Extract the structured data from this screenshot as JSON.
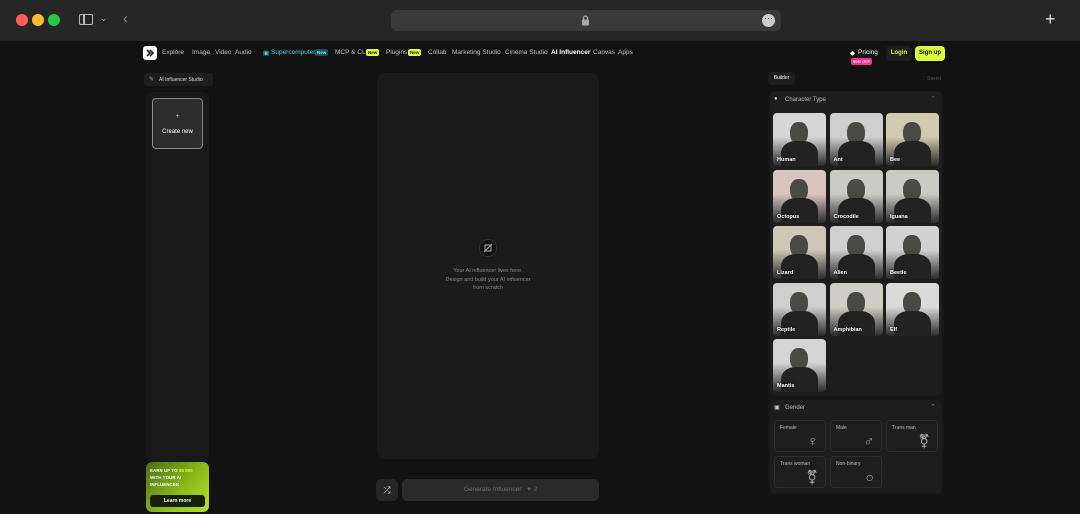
{
  "nav": {
    "items": [
      "Explore",
      "Image",
      "Video",
      "Audio"
    ],
    "supercomputer": "Supercomputer",
    "supercomputer_badge": "New",
    "mcp": "MCP & CLI",
    "mcp_badge": "New",
    "plugins": "Plugins",
    "plugins_badge": "New",
    "more": [
      "Collab",
      "Marketing Studio",
      "Cinema Studio"
    ],
    "active": "AI Influencer",
    "tail": [
      "Canvas",
      "Apps"
    ],
    "pricing": "Pricing",
    "pricing_badge": "50% OFF",
    "login": "Login",
    "signup": "Sign up"
  },
  "left": {
    "studio_tab": "AI Influencer Studio",
    "create_plus": "+",
    "create_label": "Create new",
    "promo_line1": "EARN UP TO",
    "promo_amount": "$5 000",
    "promo_line2": "WITH YOUR AI",
    "promo_line3": "INFLUENCER",
    "promo_button": "Learn more"
  },
  "center": {
    "empty_line1": "Your AI influencer lives here.",
    "empty_line2": "Design and build your AI influencer",
    "empty_line3": "from scratch",
    "generate_label": "Generate Influencer",
    "generate_cost": "2"
  },
  "right": {
    "tab_builder": "Builder",
    "tab_saved": "Saved",
    "character_title": "Character Type",
    "characters": [
      {
        "label": "Human",
        "color": "#d6d6d6"
      },
      {
        "label": "Ant",
        "color": "#cfcfcf"
      },
      {
        "label": "Bee",
        "color": "#d1c9b0"
      },
      {
        "label": "Octopus",
        "color": "#d9c4c0"
      },
      {
        "label": "Crocodile",
        "color": "#c9cbc3"
      },
      {
        "label": "Iguana",
        "color": "#c8cbc2"
      },
      {
        "label": "Lizard",
        "color": "#cfc8b8"
      },
      {
        "label": "Alien",
        "color": "#cfcfcf"
      },
      {
        "label": "Beetle",
        "color": "#d2d2d2"
      },
      {
        "label": "Reptile",
        "color": "#cfcfcf"
      },
      {
        "label": "Amphibian",
        "color": "#d0cdc4"
      },
      {
        "label": "Elf",
        "color": "#dadada"
      },
      {
        "label": "Mantis",
        "color": "#d4d4d4"
      }
    ],
    "gender_title": "Gender",
    "genders": [
      {
        "label": "Female",
        "symbol": "♀"
      },
      {
        "label": "Male",
        "symbol": "♂"
      },
      {
        "label": "Trans man",
        "symbol": "⚧"
      },
      {
        "label": "Trans woman",
        "symbol": "⚧"
      },
      {
        "label": "Non-binary",
        "symbol": "○"
      }
    ]
  },
  "colors": {
    "accent": "#d7ff3a",
    "pink": "#ff2d8d",
    "cyan": "#3ad7e5"
  }
}
